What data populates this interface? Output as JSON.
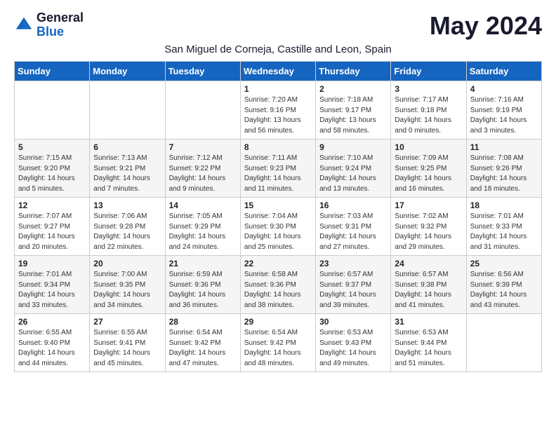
{
  "logo": {
    "general": "General",
    "blue": "Blue"
  },
  "title": "May 2024",
  "subtitle": "San Miguel de Corneja, Castille and Leon, Spain",
  "days_of_week": [
    "Sunday",
    "Monday",
    "Tuesday",
    "Wednesday",
    "Thursday",
    "Friday",
    "Saturday"
  ],
  "weeks": [
    [
      {
        "day": "",
        "info": ""
      },
      {
        "day": "",
        "info": ""
      },
      {
        "day": "",
        "info": ""
      },
      {
        "day": "1",
        "info": "Sunrise: 7:20 AM\nSunset: 9:16 PM\nDaylight: 13 hours\nand 56 minutes."
      },
      {
        "day": "2",
        "info": "Sunrise: 7:18 AM\nSunset: 9:17 PM\nDaylight: 13 hours\nand 58 minutes."
      },
      {
        "day": "3",
        "info": "Sunrise: 7:17 AM\nSunset: 9:18 PM\nDaylight: 14 hours\nand 0 minutes."
      },
      {
        "day": "4",
        "info": "Sunrise: 7:16 AM\nSunset: 9:19 PM\nDaylight: 14 hours\nand 3 minutes."
      }
    ],
    [
      {
        "day": "5",
        "info": "Sunrise: 7:15 AM\nSunset: 9:20 PM\nDaylight: 14 hours\nand 5 minutes."
      },
      {
        "day": "6",
        "info": "Sunrise: 7:13 AM\nSunset: 9:21 PM\nDaylight: 14 hours\nand 7 minutes."
      },
      {
        "day": "7",
        "info": "Sunrise: 7:12 AM\nSunset: 9:22 PM\nDaylight: 14 hours\nand 9 minutes."
      },
      {
        "day": "8",
        "info": "Sunrise: 7:11 AM\nSunset: 9:23 PM\nDaylight: 14 hours\nand 11 minutes."
      },
      {
        "day": "9",
        "info": "Sunrise: 7:10 AM\nSunset: 9:24 PM\nDaylight: 14 hours\nand 13 minutes."
      },
      {
        "day": "10",
        "info": "Sunrise: 7:09 AM\nSunset: 9:25 PM\nDaylight: 14 hours\nand 16 minutes."
      },
      {
        "day": "11",
        "info": "Sunrise: 7:08 AM\nSunset: 9:26 PM\nDaylight: 14 hours\nand 18 minutes."
      }
    ],
    [
      {
        "day": "12",
        "info": "Sunrise: 7:07 AM\nSunset: 9:27 PM\nDaylight: 14 hours\nand 20 minutes."
      },
      {
        "day": "13",
        "info": "Sunrise: 7:06 AM\nSunset: 9:28 PM\nDaylight: 14 hours\nand 22 minutes."
      },
      {
        "day": "14",
        "info": "Sunrise: 7:05 AM\nSunset: 9:29 PM\nDaylight: 14 hours\nand 24 minutes."
      },
      {
        "day": "15",
        "info": "Sunrise: 7:04 AM\nSunset: 9:30 PM\nDaylight: 14 hours\nand 25 minutes."
      },
      {
        "day": "16",
        "info": "Sunrise: 7:03 AM\nSunset: 9:31 PM\nDaylight: 14 hours\nand 27 minutes."
      },
      {
        "day": "17",
        "info": "Sunrise: 7:02 AM\nSunset: 9:32 PM\nDaylight: 14 hours\nand 29 minutes."
      },
      {
        "day": "18",
        "info": "Sunrise: 7:01 AM\nSunset: 9:33 PM\nDaylight: 14 hours\nand 31 minutes."
      }
    ],
    [
      {
        "day": "19",
        "info": "Sunrise: 7:01 AM\nSunset: 9:34 PM\nDaylight: 14 hours\nand 33 minutes."
      },
      {
        "day": "20",
        "info": "Sunrise: 7:00 AM\nSunset: 9:35 PM\nDaylight: 14 hours\nand 34 minutes."
      },
      {
        "day": "21",
        "info": "Sunrise: 6:59 AM\nSunset: 9:36 PM\nDaylight: 14 hours\nand 36 minutes."
      },
      {
        "day": "22",
        "info": "Sunrise: 6:58 AM\nSunset: 9:36 PM\nDaylight: 14 hours\nand 38 minutes."
      },
      {
        "day": "23",
        "info": "Sunrise: 6:57 AM\nSunset: 9:37 PM\nDaylight: 14 hours\nand 39 minutes."
      },
      {
        "day": "24",
        "info": "Sunrise: 6:57 AM\nSunset: 9:38 PM\nDaylight: 14 hours\nand 41 minutes."
      },
      {
        "day": "25",
        "info": "Sunrise: 6:56 AM\nSunset: 9:39 PM\nDaylight: 14 hours\nand 43 minutes."
      }
    ],
    [
      {
        "day": "26",
        "info": "Sunrise: 6:55 AM\nSunset: 9:40 PM\nDaylight: 14 hours\nand 44 minutes."
      },
      {
        "day": "27",
        "info": "Sunrise: 6:55 AM\nSunset: 9:41 PM\nDaylight: 14 hours\nand 45 minutes."
      },
      {
        "day": "28",
        "info": "Sunrise: 6:54 AM\nSunset: 9:42 PM\nDaylight: 14 hours\nand 47 minutes."
      },
      {
        "day": "29",
        "info": "Sunrise: 6:54 AM\nSunset: 9:42 PM\nDaylight: 14 hours\nand 48 minutes."
      },
      {
        "day": "30",
        "info": "Sunrise: 6:53 AM\nSunset: 9:43 PM\nDaylight: 14 hours\nand 49 minutes."
      },
      {
        "day": "31",
        "info": "Sunrise: 6:53 AM\nSunset: 9:44 PM\nDaylight: 14 hours\nand 51 minutes."
      },
      {
        "day": "",
        "info": ""
      }
    ]
  ]
}
